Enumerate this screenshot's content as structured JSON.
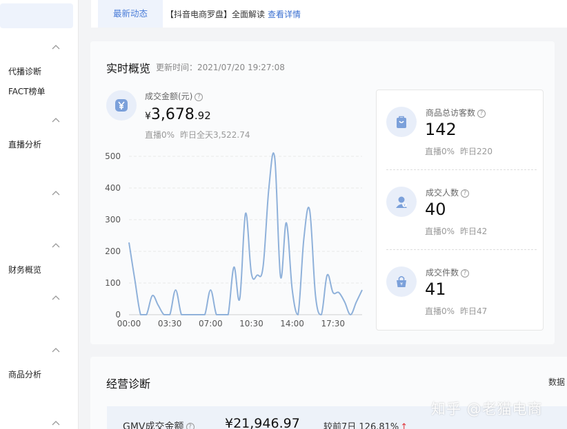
{
  "sidebar": {
    "items": [
      {
        "label": "代播诊断"
      },
      {
        "label": "FACT榜单"
      },
      {
        "label": "直播分析"
      },
      {
        "label": "财务概览"
      },
      {
        "label": "商品分析"
      }
    ]
  },
  "topbar": {
    "active_tab": "最新动态",
    "notice_text": "【抖音电商罗盘】全面解读",
    "notice_link": "查看详情"
  },
  "overview": {
    "title": "实时概览",
    "updated": "更新时间：2021/07/20 19:27:08",
    "gmv": {
      "label": "成交金额(元)",
      "currency": "¥",
      "integer": "3,678",
      "decimal": ".92",
      "live_ratio": "直播0%",
      "yesterday": "昨日全天3,522.74"
    },
    "metrics": [
      {
        "label": "商品总访客数",
        "value": "142",
        "live_ratio": "直播0%",
        "yesterday": "昨日220",
        "icon": "bag-icon"
      },
      {
        "label": "成交人数",
        "value": "40",
        "live_ratio": "直播0%",
        "yesterday": "昨日42",
        "icon": "user-icon"
      },
      {
        "label": "成交件数",
        "value": "41",
        "live_ratio": "直播0%",
        "yesterday": "昨日47",
        "icon": "basket-icon"
      }
    ]
  },
  "chart_data": {
    "type": "line",
    "x_ticks": [
      "00:00",
      "03:30",
      "07:00",
      "10:30",
      "14:00",
      "17:30"
    ],
    "y_ticks": [
      "0",
      "100",
      "200",
      "300",
      "400",
      "500"
    ],
    "ylim": [
      0,
      500
    ],
    "x_range_hours": [
      0,
      20
    ],
    "grid": true,
    "color": "#8fb1da",
    "x": [
      0,
      0.5,
      1.0,
      1.5,
      2.0,
      2.5,
      3.0,
      3.5,
      4.0,
      4.5,
      5.0,
      5.5,
      6.0,
      6.5,
      7.0,
      7.5,
      8.0,
      8.5,
      9.0,
      9.5,
      10.0,
      10.5,
      11.0,
      11.5,
      12.0,
      12.5,
      13.0,
      13.5,
      14.0,
      14.5,
      15.0,
      15.5,
      16.0,
      16.5,
      17.0,
      17.5,
      18.0,
      18.5,
      19.0,
      19.5,
      20.0
    ],
    "values": [
      228,
      110,
      0,
      0,
      60,
      30,
      0,
      0,
      78,
      0,
      0,
      0,
      0,
      0,
      78,
      0,
      0,
      0,
      150,
      50,
      320,
      130,
      125,
      150,
      400,
      495,
      120,
      290,
      80,
      0,
      240,
      330,
      60,
      0,
      125,
      70,
      70,
      40,
      0,
      40,
      78
    ]
  },
  "diagnosis": {
    "title": "经营诊断",
    "right_label": "数据",
    "gmv_label": "GMV成交金额",
    "gmv_value": "¥21,946.97",
    "gmv_compare": "较前7日 126.81%",
    "gmv_arrow": "↑"
  },
  "watermark": "知乎 @老猫电商"
}
